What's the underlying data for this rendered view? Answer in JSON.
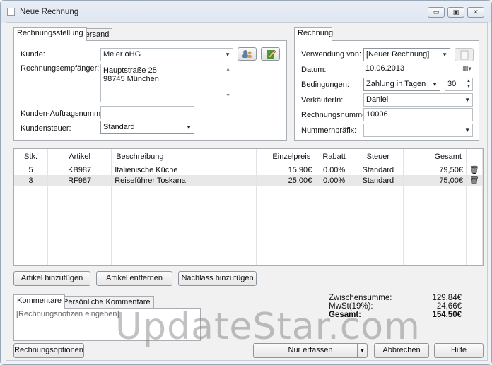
{
  "window": {
    "title": "Neue Rechnung",
    "minimize": "▭",
    "maximize": "▣",
    "close": "✕"
  },
  "left_panel": {
    "tabs": [
      "Rechnungsstellung",
      "Versand"
    ],
    "kunde_label": "Kunde:",
    "kunde_value": "Meier oHG",
    "empfaenger_label": "Rechnungsempfänger:",
    "empfaenger_line1": "Hauptstraße 25",
    "empfaenger_line2": "98745 München",
    "auftragsnummer_label": "Kunden-Auftragsnummer:",
    "auftragsnummer_value": "",
    "kundensteuer_label": "Kundensteuer:",
    "kundensteuer_value": "Standard"
  },
  "right_panel": {
    "tab": "Rechnung",
    "verwendung_label": "Verwendung von:",
    "verwendung_value": "[Neuer Rechnung]",
    "datum_label": "Datum:",
    "datum_value": "10.06.2013",
    "bedingungen_label": "Bedingungen:",
    "bedingungen_value": "Zahlung in Tagen",
    "bedingungen_days": "30",
    "verkaeufer_label": "VerkäuferIn:",
    "verkaeufer_value": "Daniel",
    "rechnungsnummer_label": "Rechnungsnummer:",
    "rechnungsnummer_value": "10006",
    "praefix_label": "Nummernpräfix:",
    "praefix_value": ""
  },
  "items_table": {
    "columns": [
      "Stk.",
      "Artikel",
      "Beschreibung",
      "Einzelpreis",
      "Rabatt",
      "Steuer",
      "Gesamt"
    ],
    "rows": [
      {
        "stk": "5",
        "artikel": "KB987",
        "beschreibung": "Italienische Küche",
        "einzelpreis": "15,90€",
        "rabatt": "0.00%",
        "steuer": "Standard",
        "gesamt": "79,50€"
      },
      {
        "stk": "3",
        "artikel": "RF987",
        "beschreibung": "Reiseführer Toskana",
        "einzelpreis": "25,00€",
        "rabatt": "0.00%",
        "steuer": "Standard",
        "gesamt": "75,00€"
      }
    ]
  },
  "item_buttons": {
    "add": "Artikel hinzufügen",
    "remove": "Artikel entfernen",
    "discount": "Nachlass hinzufügen"
  },
  "comments": {
    "tabs": [
      "Kommentare",
      "Persönliche Kommentare"
    ],
    "placeholder": "[Rechnungsnotizen eingeben]"
  },
  "totals": {
    "subtotal_label": "Zwischensumme:",
    "subtotal_value": "129,84€",
    "tax_label": "MwSt(19%):",
    "tax_value": "24,66€",
    "total_label": "Gesamt:",
    "total_value": "154,50€"
  },
  "footer": {
    "options": "Rechnungsoptionen",
    "save": "Nur erfassen",
    "cancel": "Abbrechen",
    "help": "Hilfe"
  },
  "watermark": "UpdateStar.com",
  "icons": {
    "customer_lookup": "people-icon",
    "customer_edit": "edit-icon",
    "calendar": "calendar-icon",
    "delete_row": "trash-icon"
  }
}
